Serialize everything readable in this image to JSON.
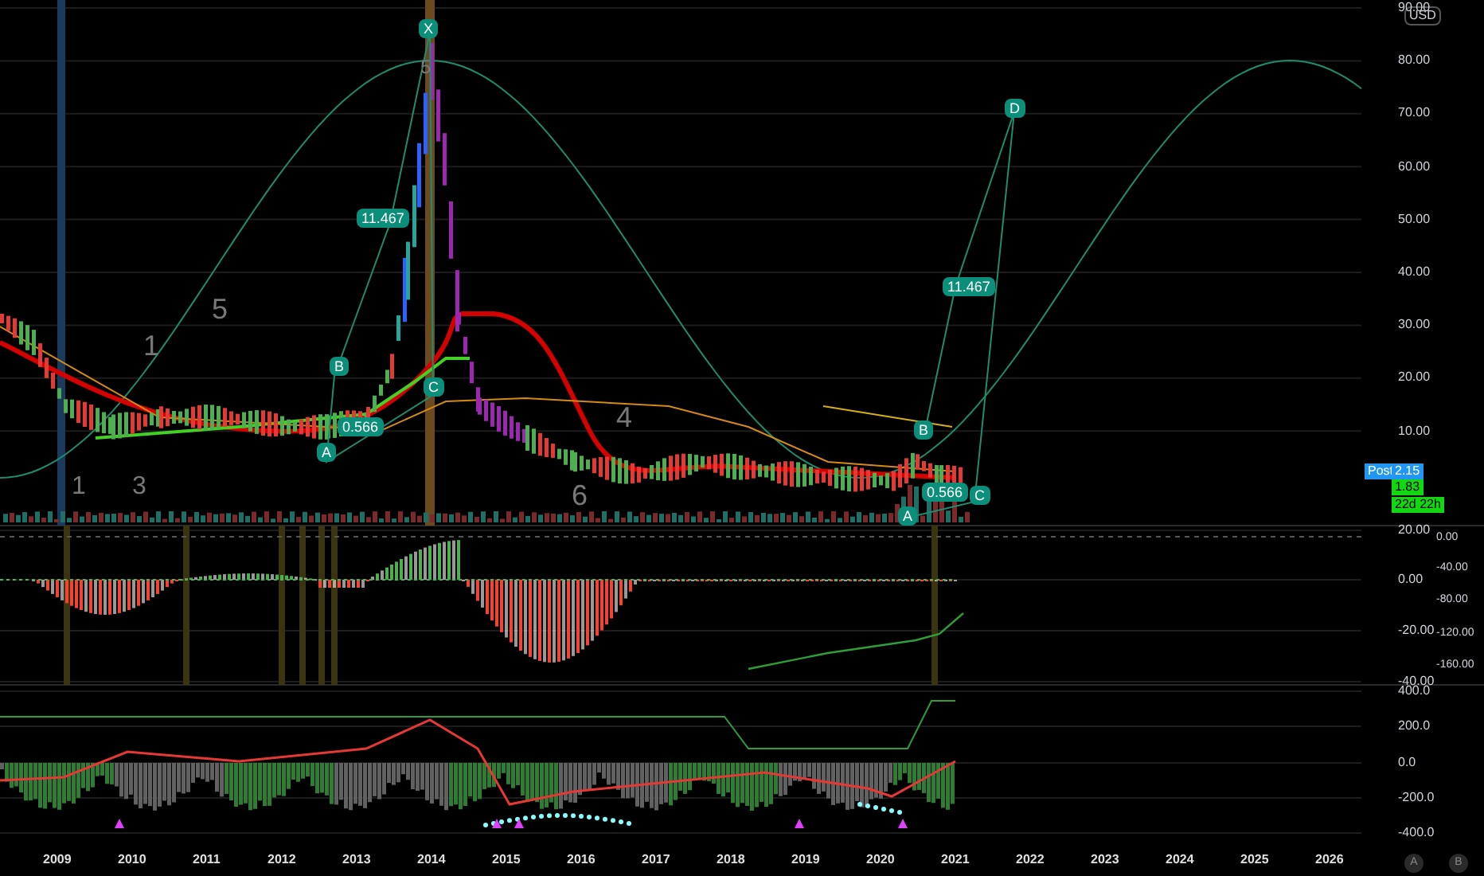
{
  "currency": "USD",
  "price_axis": [
    "90.00",
    "80.00",
    "70.00",
    "60.00",
    "50.00",
    "40.00",
    "30.00",
    "20.00",
    "10.00"
  ],
  "price_badges": [
    {
      "kind": "tag",
      "text": "Post"
    },
    {
      "kind": "post",
      "text": "2.15"
    },
    {
      "kind": "last",
      "text": "1.83"
    },
    {
      "kind": "countdown",
      "text": "22d 22h"
    }
  ],
  "pattern_labels": [
    {
      "text": "X"
    },
    {
      "text": "11.467"
    },
    {
      "text": "B"
    },
    {
      "text": "A"
    },
    {
      "text": "C"
    },
    {
      "text": "0.566"
    },
    {
      "text": "B"
    },
    {
      "text": "A"
    },
    {
      "text": "0.566"
    },
    {
      "text": "C"
    },
    {
      "text": "11.467"
    },
    {
      "text": "D"
    }
  ],
  "wave_counts": [
    "5",
    "5",
    "1",
    "3",
    "4",
    "6",
    "1"
  ],
  "oscillator_axis_a": [
    "20.00",
    "0.00",
    "-20.00",
    "-40.00"
  ],
  "oscillator_axis_b": [
    "0.00",
    "-40.00",
    "-80.00",
    "-120.00",
    "-160.00"
  ],
  "momentum_axis": [
    "400.0",
    "200.0",
    "0.0",
    "-200.0",
    "-400.0"
  ],
  "time_axis": [
    "2009",
    "2010",
    "2011",
    "2012",
    "2013",
    "2014",
    "2015",
    "2016",
    "2017",
    "2018",
    "2019",
    "2020",
    "2021",
    "2022",
    "2023",
    "2024",
    "2025",
    "2026"
  ],
  "scale_buttons": [
    "A",
    "B"
  ]
}
